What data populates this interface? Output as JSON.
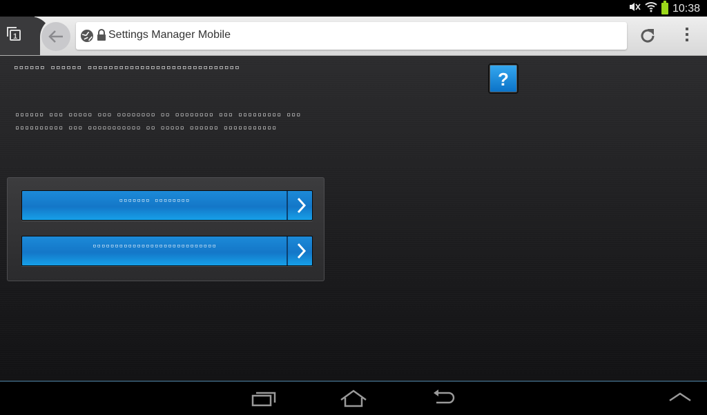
{
  "status_bar": {
    "time": "10:38",
    "icons": [
      "mute-icon",
      "wifi-icon",
      "battery-icon"
    ],
    "battery_color": "#9bd81a"
  },
  "browser": {
    "tab_count": "1",
    "url": "Settings Manager Mobile",
    "icons": [
      "tab-switcher-icon",
      "back-arrow-icon",
      "globe-icon",
      "lock-icon",
      "reload-icon",
      "overflow-menu-icon"
    ]
  },
  "page": {
    "title": "▫▫▫▫▫▫ ▫▫▫▫▫▫ ▫▫▫▫▫▫▫▫▫▫▫▫▫▫▫▫▫▫▫▫▫▫▫▫▫▫▫▫▫",
    "help_label": "?",
    "description": "▫▫▫▫▫▫ ▫▫▫ ▫▫▫▫▫ ▫▫▫ ▫▫▫▫▫▫▫▫ ▫▫ ▫▫▫▫▫▫▫▫ ▫▫▫ ▫▫▫▫▫▫▫▫▫ ▫▫▫ ▫▫▫▫▫▫▫▫▫▫ ▫▫▫ ▫▫▫▫▫▫▫▫▫▫▫ ▫▫ ▫▫▫▫▫ ▫▫▫▫▫▫ ▫▫▫▫▫▫▫▫▫▫▫",
    "buttons": [
      {
        "label": "▫▫▫▫▫▫▫ ▫▫▫▫▫▫▫▫"
      },
      {
        "label": "▫▫▫▫▫▫▫▫▫▫▫▫▫▫▫▫▫▫▫▫▫▫▫▫▫▫▫▫"
      }
    ],
    "accent_color": "#1a85d6"
  },
  "nav_bar": {
    "icons": [
      "recent-apps-icon",
      "home-icon",
      "back-icon",
      "collapse-icon"
    ]
  }
}
